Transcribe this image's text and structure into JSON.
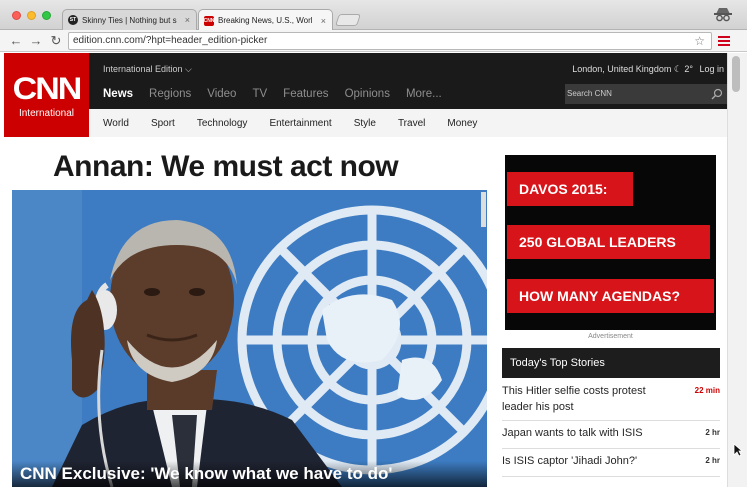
{
  "browser": {
    "tabs": [
      {
        "title": "Skinny Ties | Nothing but s",
        "favicon": "ST",
        "active": false
      },
      {
        "title": "Breaking News, U.S., Worl",
        "favicon": "CNN",
        "active": true
      }
    ],
    "tab_close_glyph": "×",
    "url": "edition.cnn.com/?hpt=header_edition-picker",
    "back_glyph": "←",
    "forward_glyph": "→",
    "reload_glyph": "↻",
    "star_glyph": "☆"
  },
  "header": {
    "logo_main": "CNN",
    "logo_sub": "International",
    "edition_picker": "International Edition ⌵",
    "location": "London, United Kingdom ☾ 2°",
    "login": "Log in",
    "primary_nav": [
      "News",
      "Regions",
      "Video",
      "TV",
      "Features",
      "Opinions",
      "More..."
    ],
    "search_placeholder": "Search CNN",
    "secondary_nav": [
      "World",
      "Sport",
      "Technology",
      "Entertainment",
      "Style",
      "Travel",
      "Money"
    ]
  },
  "main": {
    "headline": "Annan: We must act now",
    "hero_caption": "CNN Exclusive: 'We know what we have to do'"
  },
  "ad": {
    "lines": [
      "DAVOS 2015:",
      "250 GLOBAL LEADERS",
      "HOW MANY AGENDAS?"
    ],
    "label": "Advertisement"
  },
  "top_stories": {
    "title": "Today's Top Stories",
    "items": [
      {
        "title": "This Hitler selfie costs protest leader his post",
        "time": "22 min"
      },
      {
        "title": "Japan wants to talk with ISIS",
        "time": "2 hr"
      },
      {
        "title": "Is ISIS captor 'Jihadi John?'",
        "time": "2 hr"
      }
    ]
  },
  "colors": {
    "cnn_red": "#cc0000",
    "header_black": "#1a1a1a",
    "un_blue": "#3f7ec4"
  }
}
